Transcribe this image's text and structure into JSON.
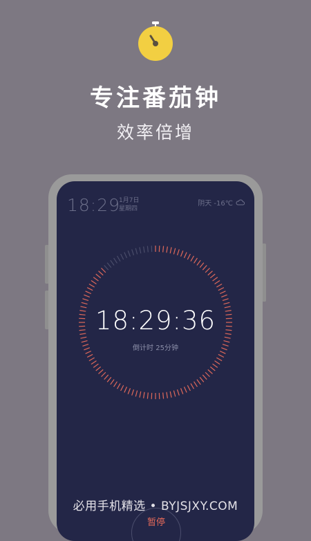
{
  "headline": "专注番茄钟",
  "subline": "效率倍增",
  "app_icon": "stopwatch-icon",
  "status": {
    "time": "18:29",
    "date_line1": "1月7日",
    "date_line2": "星期四",
    "weather": "阴天  -16℃",
    "weather_icon": "cloud-icon"
  },
  "timer": {
    "time": "18:29:36",
    "countdown": "倒计时 25分钟",
    "progress_fraction": 0.88,
    "accent_color": "#e0695a"
  },
  "pause_label": "暂停",
  "watermark": "必用手机精选 • BYJSJXY.COM",
  "colors": {
    "background": "#7d7882",
    "screen": "#232647",
    "icon_yellow": "#f2cf42"
  }
}
